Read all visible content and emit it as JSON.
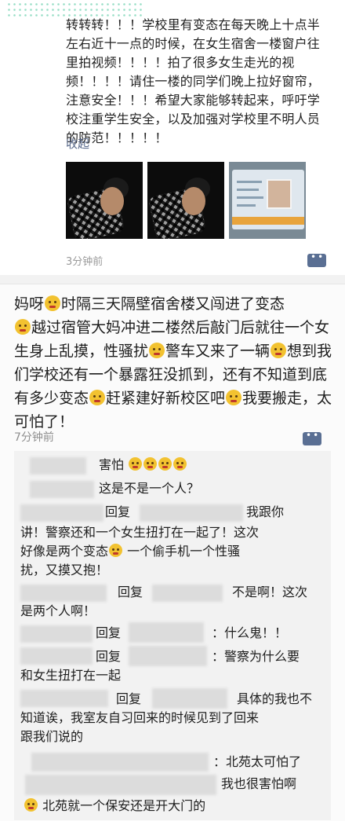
{
  "post1": {
    "text": "转转转！！！学校里有变态在每天晚上十点半左右近十一点的时候，在女生宿舍一楼窗户往里拍视频！！！！拍了很多女生走光的视频！！！！请住一楼的同学们晚上拉好窗帘，注意安全！！！希望大家能够转起来，呼吁学校注重学生安全，以及加强对学校里不明人员的防范！！！！！",
    "collapse_label": "收起",
    "time": "3分钟前",
    "images": [
      "photo-1",
      "photo-2",
      "id-card-photo"
    ]
  },
  "post2": {
    "segments": [
      "妈呀",
      "时隔三天隔壁宿舍楼又闯进了变态",
      "越过宿管大妈冲进二楼然后敲门后就往一个女生身上乱摸，性骚扰",
      "警车又来了一辆",
      "想到我们学校还有一个暴露狂没抓到，还有不知道到底有多少变态",
      "赶紧建好新校区吧",
      "我要搬走，太可怕了！"
    ],
    "time": "7分钟前"
  },
  "comments": [
    {
      "text": "害怕"
    },
    {
      "text": "这是不是一个人？"
    },
    {
      "text1": "回复",
      "text2": "我跟你",
      "text3": "讲！警察还和一个女生扭打在一起了！这次",
      "text4": "好像是两个变态",
      "text5": "一个偷手机一个性骚",
      "text6": "扰，又摸又抱！"
    },
    {
      "text1": "回复",
      "text2": "不是啊！这次",
      "text3": "是两个人啊！"
    },
    {
      "text1": "回复",
      "text2": "：什么鬼！！"
    },
    {
      "text1": "回复",
      "text2": "：警察为什么要",
      "text3": "和女生扭打在一起"
    },
    {
      "text1": "回复",
      "text2": "具体的我也不",
      "text3": "知道诶，我室友自习回来的时候见到了回来",
      "text4": "跟我们说的"
    },
    {
      "text": "：北苑太可怕了"
    },
    {
      "text1": "我也很害怕啊",
      "text2": "北苑就一个保安还是开大门的"
    }
  ]
}
